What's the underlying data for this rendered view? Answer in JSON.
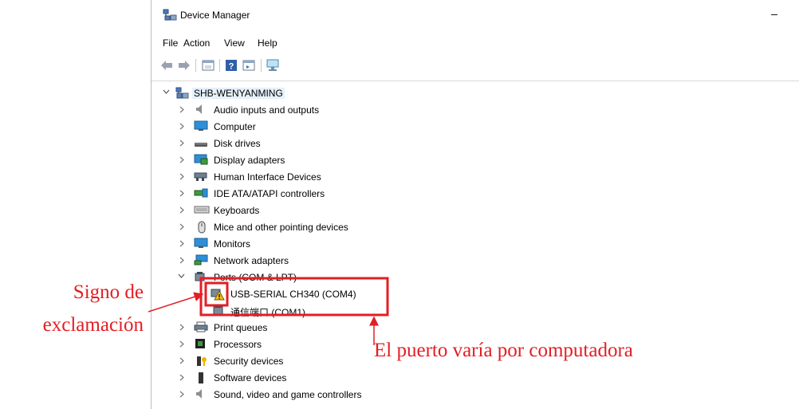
{
  "window": {
    "title": "Device Manager",
    "minimize_glyph": "–"
  },
  "menu": {
    "items": [
      "File",
      "Action",
      "View",
      "Help"
    ]
  },
  "toolbar": {
    "buttons": [
      "back-arrow-icon",
      "forward-arrow-icon",
      "properties-icon",
      "help-icon",
      "update-driver-icon",
      "scan-hardware-icon"
    ]
  },
  "tree": {
    "root": "SHB-WENYANMING",
    "categories": [
      {
        "label": "Audio inputs and outputs",
        "icon": "speaker-icon"
      },
      {
        "label": "Computer",
        "icon": "computer-icon"
      },
      {
        "label": "Disk drives",
        "icon": "disk-icon"
      },
      {
        "label": "Display adapters",
        "icon": "display-adapter-icon"
      },
      {
        "label": "Human Interface Devices",
        "icon": "hid-icon"
      },
      {
        "label": "IDE ATA/ATAPI controllers",
        "icon": "ide-icon"
      },
      {
        "label": "Keyboards",
        "icon": "keyboard-icon"
      },
      {
        "label": "Mice and other pointing devices",
        "icon": "mouse-icon"
      },
      {
        "label": "Monitors",
        "icon": "monitor-icon"
      },
      {
        "label": "Network adapters",
        "icon": "network-icon"
      },
      {
        "label": "Ports (COM & LPT)",
        "icon": "port-icon"
      }
    ],
    "ports_children": [
      {
        "label": "USB-SERIAL CH340 (COM4)",
        "icon": "warning-port-icon"
      },
      {
        "label": "通信端口 (COM1)",
        "icon": "port-icon"
      }
    ],
    "categories_after": [
      {
        "label": "Print queues",
        "icon": "printer-icon"
      },
      {
        "label": "Processors",
        "icon": "processor-icon"
      },
      {
        "label": "Security devices",
        "icon": "security-icon"
      },
      {
        "label": "Software devices",
        "icon": "software-icon"
      },
      {
        "label": "Sound, video and game controllers",
        "icon": "speaker-icon"
      }
    ]
  },
  "annotations": {
    "exclamation_line1": "Signo de",
    "exclamation_line2": "exclamación",
    "port_note": "El puerto varía por computadora",
    "color": "#e31e24"
  }
}
